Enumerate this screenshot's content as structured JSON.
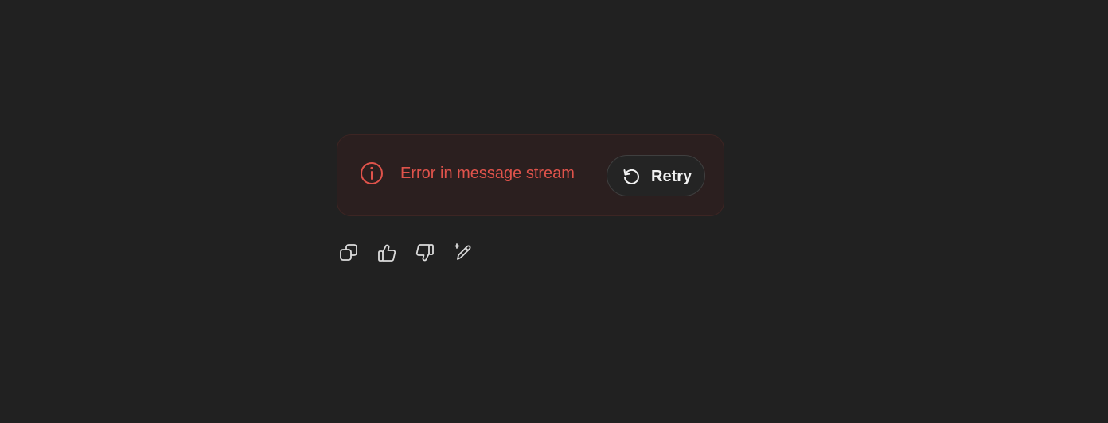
{
  "error": {
    "message": "Error in message stream",
    "icon": "info-circle-icon",
    "color": "#e0534b"
  },
  "retry": {
    "label": "Retry",
    "icon": "retry-icon"
  },
  "actions": [
    {
      "icon": "copy-icon"
    },
    {
      "icon": "thumbs-up-icon"
    },
    {
      "icon": "thumbs-down-icon"
    },
    {
      "icon": "edit-sparkle-icon"
    }
  ],
  "colors": {
    "background": "#212121",
    "error_box": "#2b1f1f",
    "icon": "#dcdcdc"
  }
}
